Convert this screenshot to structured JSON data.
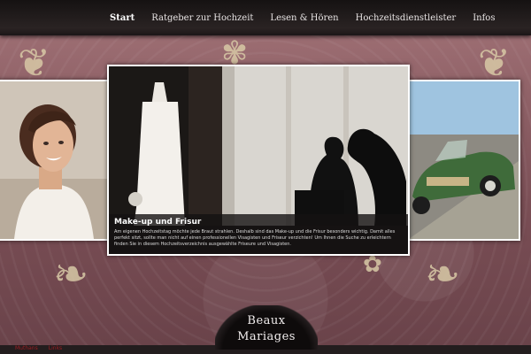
{
  "nav": {
    "items": [
      "Start",
      "Ratgeber zur Hochzeit",
      "Lesen & Hören",
      "Hochzeitsdienstleister",
      "Infos"
    ]
  },
  "slider": {
    "caption_title": "Make-up und Frisur",
    "caption_text": "Am eigenen Hochzeitstag möchte jede Braut strahlen. Deshalb sind das Make-up und die Frisur besonders wichtig. Damit alles perfekt sitzt, sollte man nicht auf einen professionellen Visagisten und Friseur verzichten! Um Ihnen die Suche zu erleichtern finden Sie in diesem Hochzeitsverzeichnis ausgewählte Friseure und Visagisten."
  },
  "logo": {
    "line1": "Beaux",
    "line2": "Mariages"
  },
  "footer": {
    "links": [
      "Muthans",
      "Links"
    ]
  },
  "colors": {
    "accent_pink": "#8c5b62",
    "ornament_gold": "#d8c9a6",
    "footer_link": "#9c1e22"
  }
}
